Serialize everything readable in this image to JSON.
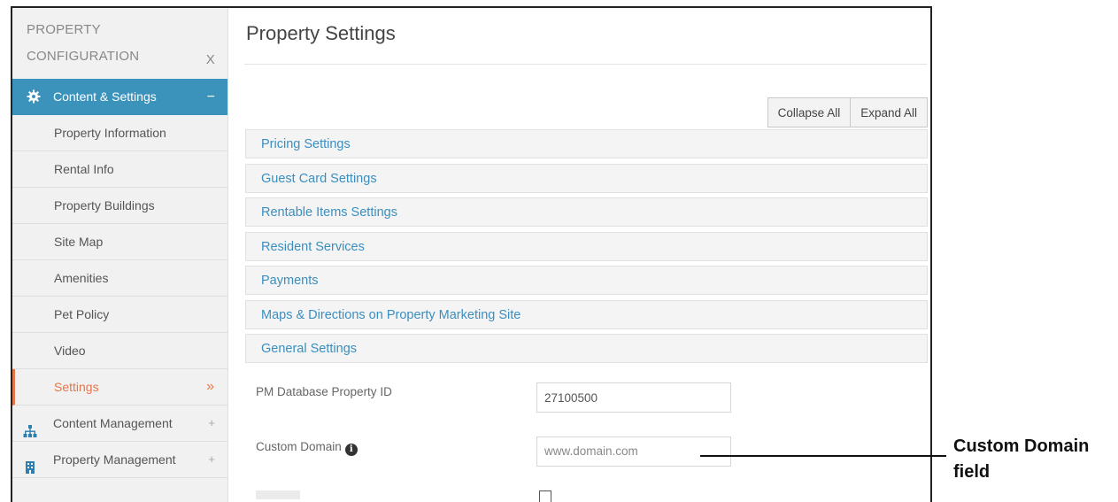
{
  "sidebar": {
    "header_line1": "PROPERTY",
    "header_line2": "CONFIGURATION",
    "close_label": "X",
    "active_section": {
      "label": "Content & Settings",
      "collapse_symbol": "−"
    },
    "items": [
      {
        "label": "Property Information"
      },
      {
        "label": "Rental Info"
      },
      {
        "label": "Property Buildings"
      },
      {
        "label": "Site Map"
      },
      {
        "label": "Amenities"
      },
      {
        "label": "Pet Policy"
      },
      {
        "label": "Video"
      },
      {
        "label": "Settings",
        "chevron": "»"
      }
    ],
    "groups": [
      {
        "label": "Content Management",
        "expand_symbol": "+"
      },
      {
        "label": "Property Management",
        "expand_symbol": "+"
      }
    ]
  },
  "main": {
    "title": "Property Settings",
    "buttons": {
      "collapse_all": "Collapse All",
      "expand_all": "Expand All"
    },
    "panels": [
      {
        "label": "Pricing Settings"
      },
      {
        "label": "Guest Card Settings"
      },
      {
        "label": "Rentable Items Settings"
      },
      {
        "label": "Resident Services"
      },
      {
        "label": "Payments"
      },
      {
        "label": "Maps & Directions on Property Marketing Site"
      },
      {
        "label": "General Settings"
      }
    ],
    "fields": {
      "pm_database_property_id": {
        "label": "PM Database Property ID",
        "value": "27100500"
      },
      "custom_domain": {
        "label": "Custom Domain",
        "placeholder": "www.domain.com",
        "info_glyph": "i"
      }
    }
  },
  "callout": {
    "line1": "Custom Domain",
    "line2": "field"
  },
  "colors": {
    "accent_blue": "#3b93bb",
    "link_blue": "#3a8fc0",
    "selected_orange": "#e2774a"
  }
}
